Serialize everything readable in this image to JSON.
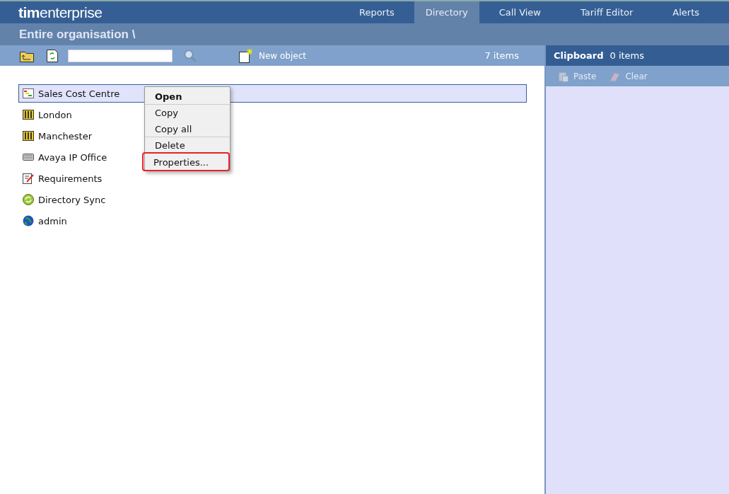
{
  "logo": "**tim**enterprise",
  "nav_tabs": [
    {
      "label": "Reports",
      "selected": false
    },
    {
      "label": "Directory",
      "selected": true
    },
    {
      "label": "Call View",
      "selected": false
    },
    {
      "label": "Tariff Editor",
      "selected": false
    },
    {
      "label": "Alerts",
      "selected": false
    }
  ],
  "breadcrumb": "Entire organisation \\",
  "toolbar": {
    "new_object": "New object",
    "item_count": "7 items"
  },
  "items": [
    {
      "name": "Sales Cost Centre",
      "kind": "costcentre",
      "selected": true
    },
    {
      "name": "London",
      "kind": "site",
      "selected": false
    },
    {
      "name": "Manchester",
      "kind": "site",
      "selected": false
    },
    {
      "name": "Avaya IP Office",
      "kind": "pbx",
      "selected": false
    },
    {
      "name": "Requirements",
      "kind": "document",
      "selected": false
    },
    {
      "name": "Directory Sync",
      "kind": "sync",
      "selected": false
    },
    {
      "name": "admin",
      "kind": "user",
      "selected": false
    }
  ],
  "context_menu": [
    {
      "label": "Open",
      "kind": "default",
      "highlighted": false,
      "separator_before": false
    },
    {
      "label": "Copy",
      "kind": "normal",
      "highlighted": false,
      "separator_before": true
    },
    {
      "label": "Copy all",
      "kind": "normal",
      "highlighted": false,
      "separator_before": false
    },
    {
      "label": "Delete",
      "kind": "normal",
      "highlighted": false,
      "separator_before": true
    },
    {
      "label": "Properties...",
      "kind": "normal",
      "highlighted": true,
      "separator_before": false
    }
  ],
  "clipboard": {
    "title": "Clipboard",
    "count": "0 items",
    "actions": [
      {
        "label": "Paste",
        "kind": "paste",
        "disabled": true
      },
      {
        "label": "Clear",
        "kind": "clear",
        "disabled": true
      }
    ]
  }
}
